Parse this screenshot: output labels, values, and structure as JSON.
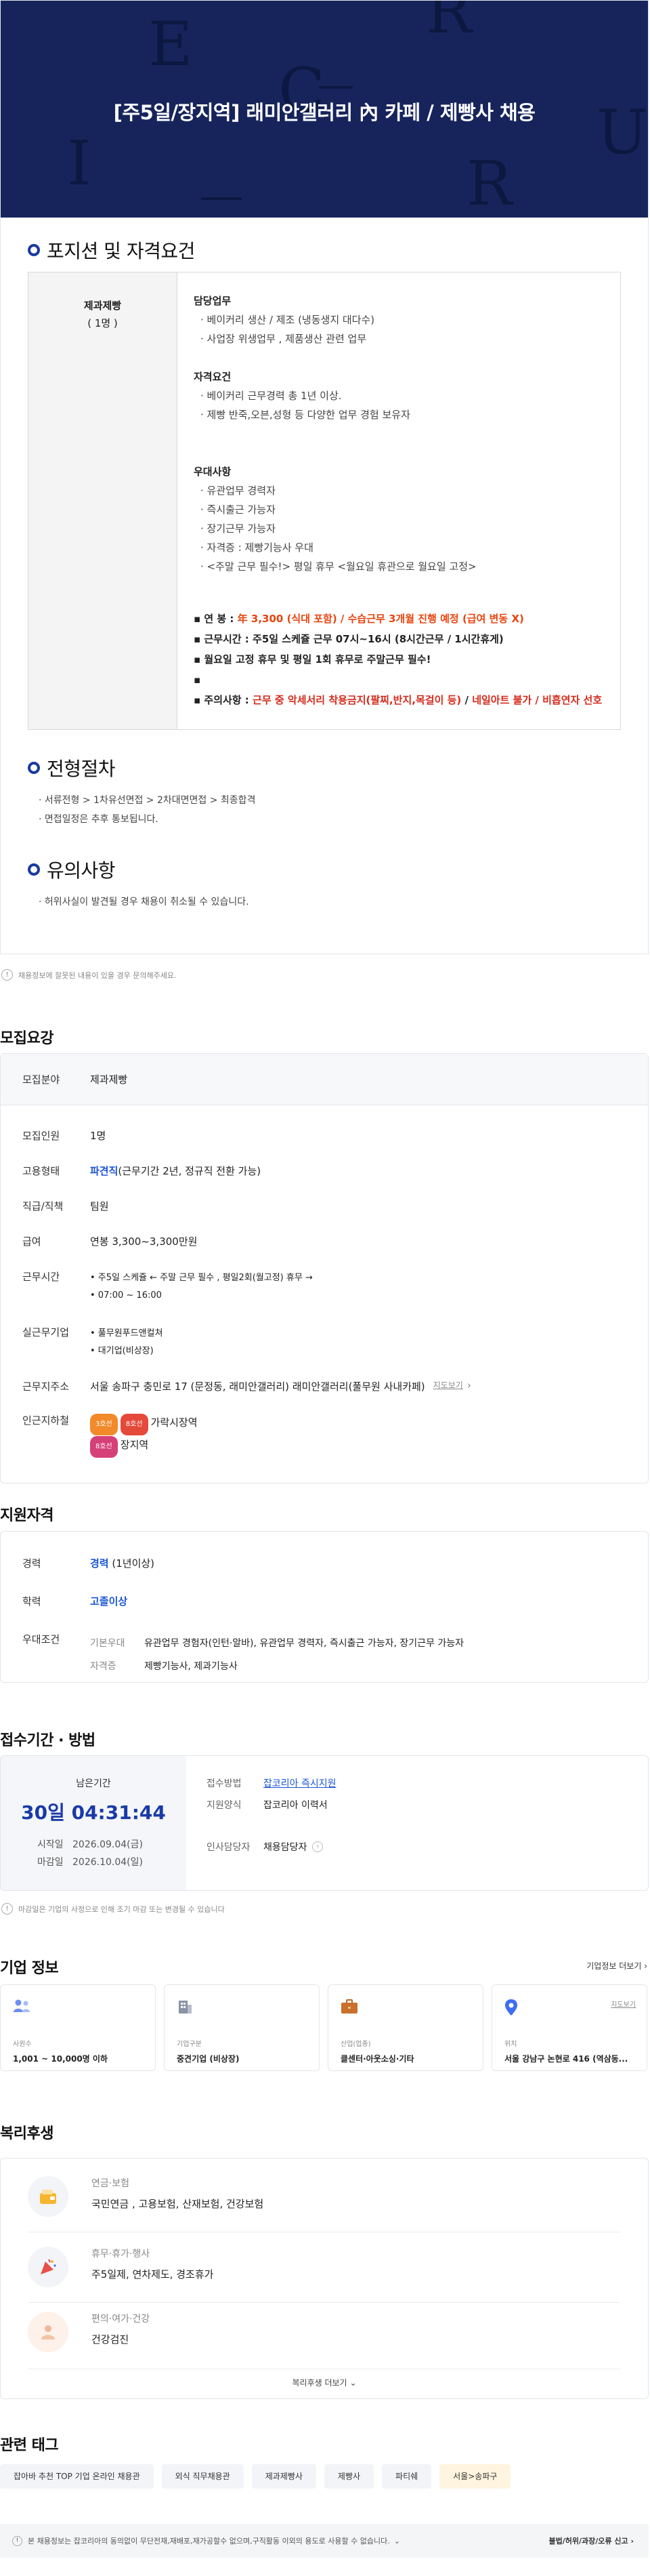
{
  "title": "[주5일/장지역] 래미안갤러리 內 카페 / 제빵사 채용",
  "hero_letters": [
    "E",
    "R",
    "C",
    "U",
    "I",
    "R"
  ],
  "colors": {
    "hero": "#17245c",
    "accent_blue": "#1c56d6",
    "orange": "#e8440e",
    "red": "#d52a1b"
  },
  "position": {
    "heading": "포지션 및 자격요건",
    "role": "제과제빵",
    "count": "( 1명 )",
    "duties_title": "담당업무",
    "duties": [
      "· 베이커리 생산 / 제조 (냉동생지 대다수)",
      "· 사업장 위생업무 , 제품생산 관련 업무"
    ],
    "req_title": "자격요건",
    "reqs": [
      "· 베이커리 근무경력 총 1년 이상.",
      "· 제빵 반죽,오븐,성형 등 다양한 업무 경험 보유자"
    ],
    "pref_title": "우대사항",
    "prefs": [
      "· 유관업무 경력자",
      "· 즉시출근 가능자",
      "· 장기근무 가능자",
      "· 자격증 : 제빵기능사 우대",
      "· <주말 근무 필수!> 평일 휴무 <월요일 휴관으로 월요일 고정>"
    ],
    "salary_label": "▪ 연      봉 :",
    "salary_value": "年 3,300 (식대 포함) / 수습근무 3개월 진행 예정 (급여 변동 X)",
    "hours": "▪ 근무시간 : 주5일 스케쥴 근무 07시~16시 (8시간근무 / 1시간휴게)",
    "holiday": "▪ 월요일 고정 휴무 및 평일 1회 휴무로 주말근무 필수!",
    "bullet_empty": "▪",
    "notice_label": "▪ 주의사항 :",
    "notice_red": "근무 중 악세서리 착용금지(팔찌,반지,목걸이 등)",
    "notice_mid": " / ",
    "notice_red2": "네일아트 불가 / 비흡연자 선호"
  },
  "process": {
    "heading": "전형절차",
    "steps": "· 서류전형 > 1차유선면접 > 2차대면면접 > 최종합격",
    "note": "· 면접일정은 추후 통보됩니다."
  },
  "caution": {
    "heading": "유의사항",
    "text": "· 허위사실이 발견될 경우 채용이 취소될 수 있습니다."
  },
  "hint": {
    "icon": "!",
    "text": "채용정보에 잘못된 내용이 있을 경우 문의해주세요."
  },
  "recruit": {
    "heading": "모집요강",
    "field_label": "모집분야",
    "field_value": "제과제빵",
    "count_label": "모집인원",
    "count_value": "1명",
    "type_label": "고용형태",
    "type_blue": "파견직",
    "type_rest": "(근무기간 2년, 정규직 전환 가능)",
    "rank_label": "직급/직책",
    "rank_value": "팀원",
    "pay_label": "급여",
    "pay_value": "연봉 3,300~3,300만원",
    "hours_label": "근무시간",
    "hours_1": "• 주5일 스케쥴 ← 주말 근무 필수 , 평일2회(월고정) 휴무 →",
    "hours_2": "• 07:00 ~ 16:00",
    "company_label": "실근무기업",
    "company_1": "• 풀무원푸드앤컬쳐",
    "company_2": "• 대기업(비상장)",
    "address_label": "근무지주소",
    "address_value": "서울 송파구 충민로 17 (문정동, 래미안갤러리) 래미안갤러리(풀무원 사내카페)",
    "map_link": "지도보기",
    "station_label": "인근지하철",
    "badge1": "3호선",
    "badge2": "8호선",
    "station1": "가락시장역",
    "badge3": "8호선",
    "station2": "장지역"
  },
  "qualification": {
    "heading": "지원자격",
    "exp_label": "경력",
    "exp_blue": "경력",
    "exp_rest": " (1년이상)",
    "edu_label": "학력",
    "edu_value": "고졸이상",
    "pref_label": "우대조건",
    "basic_label": "기본우대",
    "basic_value": "유관업무 경험자(인턴·알바), 유관업무 경력자, 즉시출근 가능자, 장기근무 가능자",
    "cert_label": "자격증",
    "cert_value": "제빵기능사, 제과기능사"
  },
  "apply": {
    "heading": "접수기간 · 방법",
    "remain_label": "남은기간",
    "remain_value": "30일 04:31:44",
    "start_label": "시작일",
    "start_value": "2026.09.04(금)",
    "end_label": "마감일",
    "end_value": "2026.10.04(일)",
    "method_label": "접수방법",
    "method_value": "잡코리아 즉시지원",
    "form_label": "지원양식",
    "form_value": "잡코리아 이력서",
    "contact_label": "인사담당자",
    "contact_value": "채용담당자",
    "note": "마감일은 기업의 사정으로 인해 조기 마감 또는 변경될 수 있습니다"
  },
  "company": {
    "heading": "기업 정보",
    "more": "기업정보 더보기",
    "cards": [
      {
        "icon": "people-icon",
        "label": "사원수",
        "value": "1,001 ~ 10,000명 이하"
      },
      {
        "icon": "building-icon",
        "label": "기업구분",
        "value": "중견기업 (비상장)"
      },
      {
        "icon": "briefcase-icon",
        "label": "산업(업종)",
        "value": "클센터·아웃소싱·기타"
      },
      {
        "icon": "pin-icon",
        "label": "위치",
        "value": "서울 강남구 논현로 416 (역삼동...",
        "link": "지도보기"
      }
    ]
  },
  "benefit": {
    "heading": "복리후생",
    "rows": [
      {
        "icon": "wallet-icon",
        "category": "연금·보험",
        "items": "국민연금 , 고용보험, 산재보험, 건강보험"
      },
      {
        "icon": "party-icon",
        "category": "휴무·휴가·행사",
        "items": "주5일제, 연차제도, 경조휴가"
      },
      {
        "icon": "health-icon",
        "category": "편의·여가·건강",
        "items": "건강검진"
      }
    ],
    "more": "복리후생 더보기"
  },
  "tags": {
    "heading": "관련 태그",
    "items": [
      "잡아바 추천 TOP 기업 온라인 채용관",
      "외식 직무채용관",
      "제과제빵사",
      "제빵사",
      "파티쉐",
      "서울>송파구"
    ]
  },
  "footer": {
    "text": "본 채용정보는 잡코리아의 동의없이 무단전재,재배포,재가공할수 없으며,구직활동 이외의 용도로 사용할 수 없습니다.",
    "report": "불법/허위/과장/오류 신고"
  }
}
